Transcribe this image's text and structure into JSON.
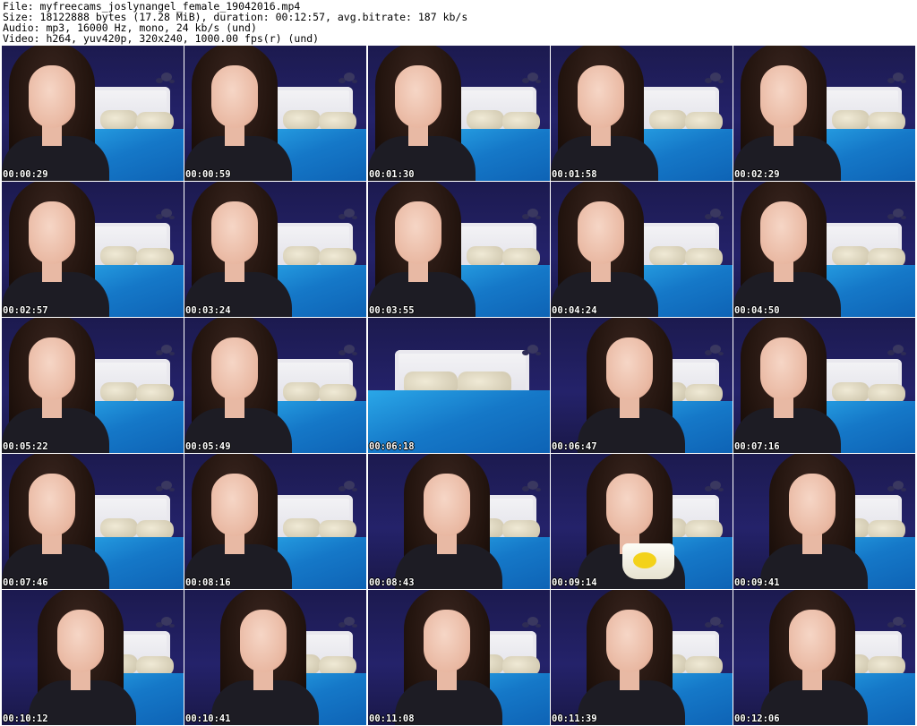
{
  "header": {
    "file": "File: myfreecams_joslynangel_female_19042016.mp4",
    "size": "Size: 18122888 bytes (17.28 MiB), duration: 00:12:57, avg.bitrate: 187 kb/s",
    "audio": "Audio: mp3, 16000 Hz, mono, 24 kb/s (und)",
    "video": "Video: h264, yuv420p, 320x240, 1000.00 fps(r) (und)"
  },
  "thumbnails": [
    {
      "timestamp": "00:00:29",
      "pose": "left"
    },
    {
      "timestamp": "00:00:59",
      "pose": "left"
    },
    {
      "timestamp": "00:01:30",
      "pose": "left"
    },
    {
      "timestamp": "00:01:58",
      "pose": "left"
    },
    {
      "timestamp": "00:02:29",
      "pose": "left"
    },
    {
      "timestamp": "00:02:57",
      "pose": "left"
    },
    {
      "timestamp": "00:03:24",
      "pose": "left"
    },
    {
      "timestamp": "00:03:55",
      "pose": "left"
    },
    {
      "timestamp": "00:04:24",
      "pose": "left"
    },
    {
      "timestamp": "00:04:50",
      "pose": "left"
    },
    {
      "timestamp": "00:05:22",
      "pose": "left"
    },
    {
      "timestamp": "00:05:49",
      "pose": "left"
    },
    {
      "timestamp": "00:06:18",
      "pose": "empty"
    },
    {
      "timestamp": "00:06:47",
      "pose": "shift"
    },
    {
      "timestamp": "00:07:16",
      "pose": "left"
    },
    {
      "timestamp": "00:07:46",
      "pose": "left"
    },
    {
      "timestamp": "00:08:16",
      "pose": "left"
    },
    {
      "timestamp": "00:08:43",
      "pose": "shift"
    },
    {
      "timestamp": "00:09:14",
      "pose": "shift",
      "mug": true
    },
    {
      "timestamp": "00:09:41",
      "pose": "shift"
    },
    {
      "timestamp": "00:10:12",
      "pose": "shift"
    },
    {
      "timestamp": "00:10:41",
      "pose": "shift"
    },
    {
      "timestamp": "00:11:08",
      "pose": "shift"
    },
    {
      "timestamp": "00:11:39",
      "pose": "shift"
    },
    {
      "timestamp": "00:12:06",
      "pose": "shift"
    }
  ]
}
